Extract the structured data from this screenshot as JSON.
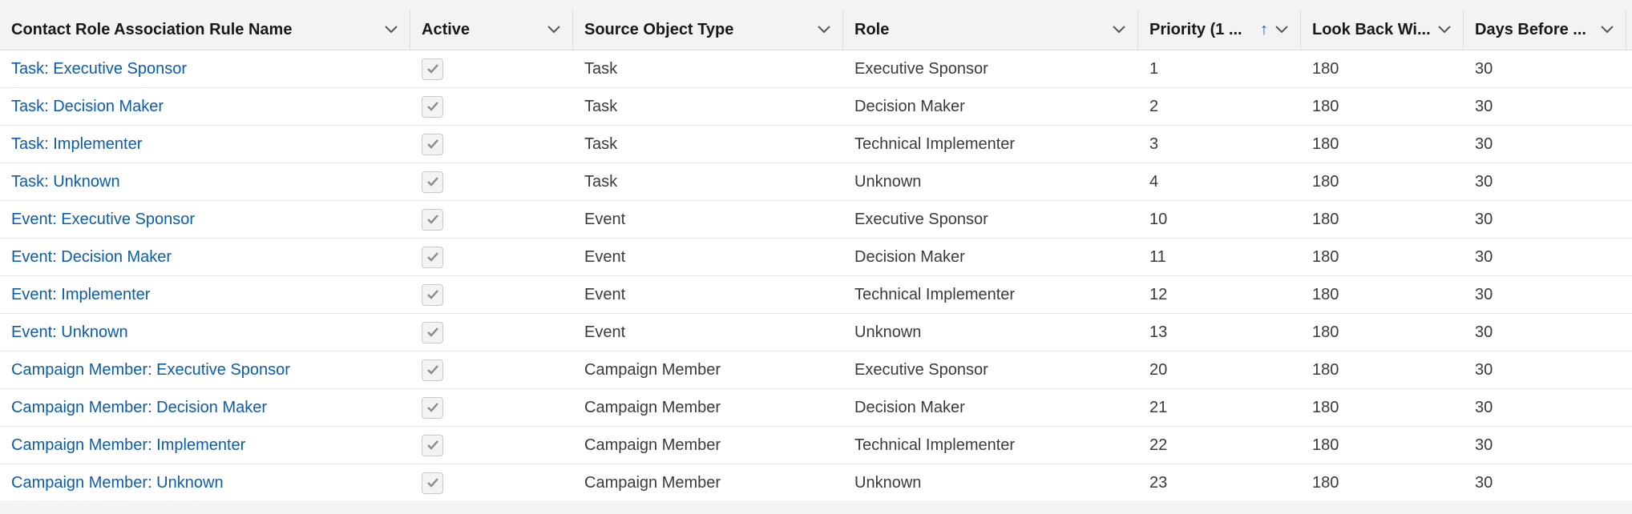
{
  "columns": [
    {
      "label": "Contact Role Association Rule Name",
      "sorted": false
    },
    {
      "label": "Active",
      "sorted": false
    },
    {
      "label": "Source Object Type",
      "sorted": false
    },
    {
      "label": "Role",
      "sorted": false
    },
    {
      "label": "Priority (1 ...",
      "sorted": true,
      "sort_icon": "arrow-up-icon"
    },
    {
      "label": "Look Back Wi...",
      "sorted": false
    },
    {
      "label": "Days Before ...",
      "sorted": false
    }
  ],
  "rows": [
    {
      "name": "Task: Executive Sponsor",
      "active": true,
      "source": "Task",
      "role": "Executive Sponsor",
      "priority": "1",
      "lookback": "180",
      "days_before": "30"
    },
    {
      "name": "Task: Decision Maker",
      "active": true,
      "source": "Task",
      "role": "Decision Maker",
      "priority": "2",
      "lookback": "180",
      "days_before": "30"
    },
    {
      "name": "Task: Implementer",
      "active": true,
      "source": "Task",
      "role": "Technical Implementer",
      "priority": "3",
      "lookback": "180",
      "days_before": "30"
    },
    {
      "name": "Task: Unknown",
      "active": true,
      "source": "Task",
      "role": "Unknown",
      "priority": "4",
      "lookback": "180",
      "days_before": "30"
    },
    {
      "name": "Event: Executive Sponsor",
      "active": true,
      "source": "Event",
      "role": "Executive Sponsor",
      "priority": "10",
      "lookback": "180",
      "days_before": "30"
    },
    {
      "name": "Event: Decision Maker",
      "active": true,
      "source": "Event",
      "role": "Decision Maker",
      "priority": "11",
      "lookback": "180",
      "days_before": "30"
    },
    {
      "name": "Event: Implementer",
      "active": true,
      "source": "Event",
      "role": "Technical Implementer",
      "priority": "12",
      "lookback": "180",
      "days_before": "30"
    },
    {
      "name": "Event: Unknown",
      "active": true,
      "source": "Event",
      "role": "Unknown",
      "priority": "13",
      "lookback": "180",
      "days_before": "30"
    },
    {
      "name": "Campaign Member: Executive Sponsor",
      "active": true,
      "source": "Campaign Member",
      "role": "Executive Sponsor",
      "priority": "20",
      "lookback": "180",
      "days_before": "30"
    },
    {
      "name": "Campaign Member: Decision Maker",
      "active": true,
      "source": "Campaign Member",
      "role": "Decision Maker",
      "priority": "21",
      "lookback": "180",
      "days_before": "30"
    },
    {
      "name": "Campaign Member: Implementer",
      "active": true,
      "source": "Campaign Member",
      "role": "Technical Implementer",
      "priority": "22",
      "lookback": "180",
      "days_before": "30"
    },
    {
      "name": "Campaign Member: Unknown",
      "active": true,
      "source": "Campaign Member",
      "role": "Unknown",
      "priority": "23",
      "lookback": "180",
      "days_before": "30"
    }
  ],
  "icons": {
    "column_menu": "chevron-down-icon",
    "checkbox": "checkmark-icon"
  },
  "colors": {
    "link": "#0b5cab",
    "header_bg": "#f3f3f3",
    "sort_arrow": "#0b5cab"
  }
}
